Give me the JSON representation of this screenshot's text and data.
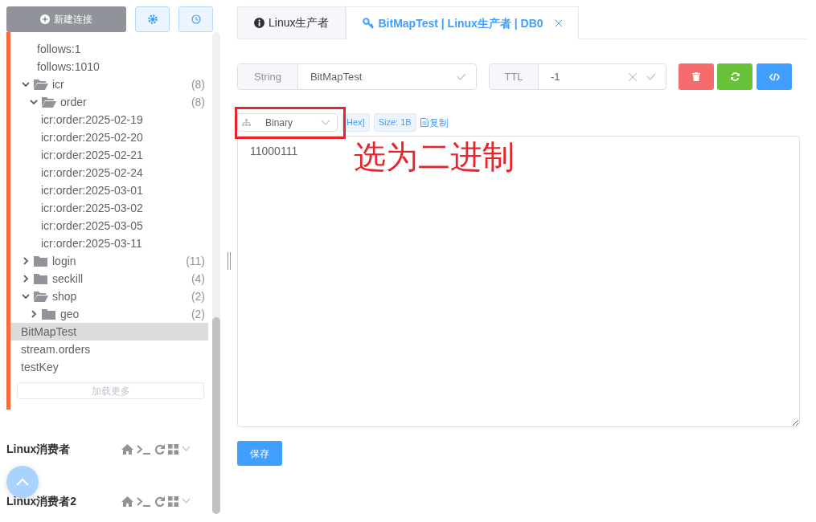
{
  "sidebar": {
    "new_connection": "新建连接",
    "tree": [
      {
        "kind": "group",
        "children": [
          {
            "kind": "key",
            "label": "follows:1",
            "selected": false
          },
          {
            "kind": "key",
            "label": "follows:1010",
            "selected": false
          }
        ]
      },
      {
        "kind": "folder",
        "label": "icr",
        "count": "(8)",
        "expanded": true,
        "children": [
          {
            "kind": "folder",
            "label": "order",
            "count": "(8)",
            "expanded": true,
            "children": [
              {
                "kind": "key",
                "label": "icr:order:2025-02-19",
                "selected": false
              },
              {
                "kind": "key",
                "label": "icr:order:2025-02-20",
                "selected": false
              },
              {
                "kind": "key",
                "label": "icr:order:2025-02-21",
                "selected": false
              },
              {
                "kind": "key",
                "label": "icr:order:2025-02-24",
                "selected": false
              },
              {
                "kind": "key",
                "label": "icr:order:2025-03-01",
                "selected": false
              },
              {
                "kind": "key",
                "label": "icr:order:2025-03-02",
                "selected": false
              },
              {
                "kind": "key",
                "label": "icr:order:2025-03-05",
                "selected": false
              },
              {
                "kind": "key",
                "label": "icr:order:2025-03-11",
                "selected": false
              }
            ]
          }
        ]
      },
      {
        "kind": "folder",
        "label": "login",
        "count": "(11)",
        "expanded": false
      },
      {
        "kind": "folder",
        "label": "seckill",
        "count": "(4)",
        "expanded": false
      },
      {
        "kind": "folder",
        "label": "shop",
        "count": "(2)",
        "expanded": true,
        "children": [
          {
            "kind": "folder",
            "label": "geo",
            "count": "(2)",
            "expanded": false
          }
        ]
      },
      {
        "kind": "key",
        "label": "BitMapTest",
        "selected": true
      },
      {
        "kind": "key",
        "label": "stream.orders",
        "selected": false
      },
      {
        "kind": "key",
        "label": "testKey",
        "selected": false
      }
    ],
    "load_more": "加载更多",
    "connections": [
      {
        "name": "Linux消费者"
      },
      {
        "name": "Linux消费者2"
      }
    ]
  },
  "tabs": [
    {
      "label": "Linux生产者",
      "kind": "info",
      "selected": false,
      "closable": false
    },
    {
      "label": "BitMapTest | Linux生产者 | DB0",
      "kind": "key",
      "selected": true,
      "closable": true
    }
  ],
  "key_row": {
    "type": "String",
    "name": "BitMapTest",
    "ttl_label": "TTL",
    "ttl": "-1"
  },
  "format": {
    "selected": "Binary",
    "tags": [
      "Hex]",
      "Size: 1B"
    ],
    "copy": "复制"
  },
  "value": "11000111",
  "annotation": "选为二进制",
  "save": "保存"
}
